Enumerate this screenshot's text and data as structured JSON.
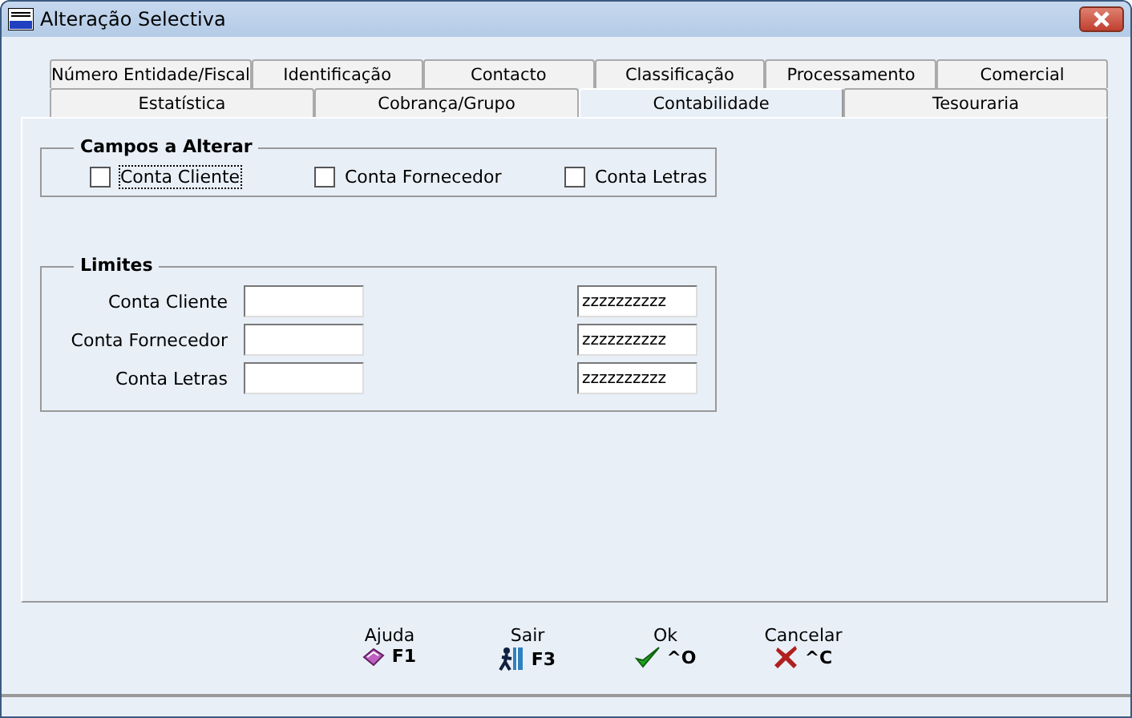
{
  "window": {
    "title": "Alteração Selectiva"
  },
  "tab_rows": [
    [
      {
        "label": "Número Entidade/Fiscal",
        "selected": false
      },
      {
        "label": "Identificação",
        "selected": false
      },
      {
        "label": "Contacto",
        "selected": false
      },
      {
        "label": "Classificação",
        "selected": false
      },
      {
        "label": "Processamento",
        "selected": false
      },
      {
        "label": "Comercial",
        "selected": false
      }
    ],
    [
      {
        "label": "Estatística",
        "selected": false
      },
      {
        "label": "Cobrança/Grupo",
        "selected": false
      },
      {
        "label": "Contabilidade",
        "selected": true
      },
      {
        "label": "Tesouraria",
        "selected": false
      }
    ]
  ],
  "campos": {
    "title": "Campos a Alterar",
    "items": [
      {
        "label": "Conta Cliente",
        "checked": false,
        "focused": true
      },
      {
        "label": "Conta Fornecedor",
        "checked": false,
        "focused": false
      },
      {
        "label": "Conta Letras",
        "checked": false,
        "focused": false
      }
    ]
  },
  "limites": {
    "title": "Limites",
    "rows": [
      {
        "label": "Conta Cliente",
        "from": "",
        "to": "zzzzzzzzzz"
      },
      {
        "label": "Conta Fornecedor",
        "from": "",
        "to": "zzzzzzzzzz"
      },
      {
        "label": "Conta Letras",
        "from": "",
        "to": "zzzzzzzzzz"
      }
    ]
  },
  "buttons": [
    {
      "kind": "help",
      "label": "Ajuda",
      "key": "F1"
    },
    {
      "kind": "exit",
      "label": "Sair",
      "key": "F3"
    },
    {
      "kind": "ok",
      "label": "Ok",
      "key": "^O"
    },
    {
      "kind": "cancel",
      "label": "Cancelar",
      "key": "^C"
    }
  ]
}
